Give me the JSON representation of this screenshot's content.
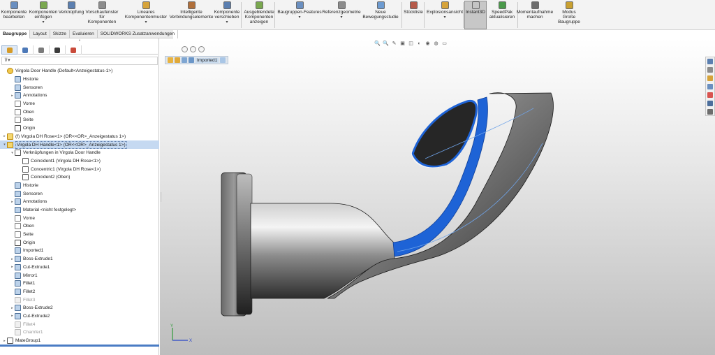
{
  "ribbon": {
    "buttons": [
      {
        "label": "Komponente\nbearbeiten",
        "icon": "edit-component-icon",
        "dropdown": false
      },
      {
        "label": "Komponenten\neinfügen",
        "icon": "insert-components-icon",
        "dropdown": true
      },
      {
        "label": "Verknüpfung",
        "icon": "mate-icon",
        "dropdown": false
      },
      {
        "label": "Vorschaufenster\nfür\nKomponenten",
        "icon": "component-preview-icon",
        "dropdown": false
      },
      {
        "label": "Lineares\nKomponentenmuster",
        "icon": "linear-pattern-icon",
        "dropdown": true
      },
      {
        "label": "Intelligente\nVerbindungselemente",
        "icon": "smart-fasteners-icon",
        "dropdown": false
      },
      {
        "label": "Komponente\nverschieben",
        "icon": "move-component-icon",
        "dropdown": true
      },
      {
        "label": "Ausgeblendete\nKomponenten\nanzeigen",
        "icon": "show-hidden-icon",
        "dropdown": false
      },
      {
        "label": "Baugruppen-Features",
        "icon": "assembly-features-icon",
        "dropdown": true
      },
      {
        "label": "Referenzgeometrie",
        "icon": "reference-geometry-icon",
        "dropdown": true
      },
      {
        "label": "Neue\nBewegungsstudie",
        "icon": "motion-study-icon",
        "dropdown": false
      },
      {
        "label": "Stückliste",
        "icon": "bom-icon",
        "dropdown": false
      },
      {
        "label": "Explosionsansicht",
        "icon": "exploded-view-icon",
        "dropdown": true
      },
      {
        "label": "Instant3D",
        "icon": "instant3d-icon",
        "dropdown": false
      },
      {
        "label": "SpeedPak\naktualisieren",
        "icon": "speedpak-icon",
        "dropdown": false
      },
      {
        "label": "Momentaufnahme\nmachen",
        "icon": "snapshot-icon",
        "dropdown": false
      },
      {
        "label": "Modus\nGroße\nBaugruppe",
        "icon": "large-assembly-icon",
        "dropdown": false
      }
    ],
    "dropdown_glyph": "▾",
    "active": "Instant3D"
  },
  "command_tabs": [
    "Baugruppe",
    "Layout",
    "Skizze",
    "Evaluieren",
    "SOLIDWORKS Zusatzanwendungen"
  ],
  "manager_tabs": [
    {
      "name": "featuremanager-tab",
      "icon": "featuremanager-icon",
      "color": "#d69b27"
    },
    {
      "name": "propertymanager-tab",
      "icon": "propertymanager-icon",
      "color": "#4d79b8"
    },
    {
      "name": "configurationmanager-tab",
      "icon": "configurationmanager-icon",
      "color": "#7a7a7a"
    },
    {
      "name": "dimxpertmanager-tab",
      "icon": "dimxpert-icon",
      "color": "#3b3b3b"
    },
    {
      "name": "displaymanager-tab",
      "icon": "displaymanager-icon",
      "color": "#c94a3a"
    }
  ],
  "filter": {
    "glyph": "▾"
  },
  "gripper_glyph": "•",
  "tree": [
    {
      "label": "Virgola Door Handle  (Default<Anzeigestatus-1>)",
      "icon": "asm",
      "indent": 0,
      "expand": ""
    },
    {
      "label": "Historie",
      "icon": "feat",
      "indent": 1,
      "expand": ""
    },
    {
      "label": "Sensoren",
      "icon": "feat",
      "indent": 1,
      "expand": ""
    },
    {
      "label": "Annotations",
      "icon": "feat",
      "indent": 1,
      "expand": "▸"
    },
    {
      "label": "Vorne",
      "icon": "plane",
      "indent": 1,
      "expand": ""
    },
    {
      "label": "Oben",
      "icon": "plane",
      "indent": 1,
      "expand": ""
    },
    {
      "label": "Seite",
      "icon": "plane",
      "indent": 1,
      "expand": ""
    },
    {
      "label": "Origin",
      "icon": "origin",
      "indent": 1,
      "expand": ""
    },
    {
      "label": "(f) Virgola DH Rose<1> (OR<<OR>_Anzeigestatus 1>)",
      "icon": "part",
      "indent": 0,
      "expand": "▸"
    },
    {
      "label": "Virgola DH Handle<1> (OR<<OR>_Anzeigestatus 1>)",
      "icon": "part",
      "indent": 0,
      "expand": "▾",
      "selected": true
    },
    {
      "label": "Verknüpfungen in Virgola Door Handle",
      "icon": "mate",
      "indent": 1,
      "expand": "▾"
    },
    {
      "label": "Coincident1 (Virgola DH Rose<1>)",
      "icon": "mate",
      "indent": 2,
      "expand": ""
    },
    {
      "label": "Concentric1 (Virgola DH Rose<1>)",
      "icon": "mate",
      "indent": 2,
      "expand": ""
    },
    {
      "label": "Coincident2 (Oben)",
      "icon": "mate",
      "indent": 2,
      "expand": ""
    },
    {
      "label": "Historie",
      "icon": "feat",
      "indent": 1,
      "expand": ""
    },
    {
      "label": "Sensoren",
      "icon": "feat",
      "indent": 1,
      "expand": ""
    },
    {
      "label": "Annotations",
      "icon": "feat",
      "indent": 1,
      "expand": "▸"
    },
    {
      "label": "Material <nicht festgelegt>",
      "icon": "feat",
      "indent": 1,
      "expand": ""
    },
    {
      "label": "Vorne",
      "icon": "plane",
      "indent": 1,
      "expand": ""
    },
    {
      "label": "Oben",
      "icon": "plane",
      "indent": 1,
      "expand": ""
    },
    {
      "label": "Seite",
      "icon": "plane",
      "indent": 1,
      "expand": ""
    },
    {
      "label": "Origin",
      "icon": "origin",
      "indent": 1,
      "expand": ""
    },
    {
      "label": "Imported1",
      "icon": "feat",
      "indent": 1,
      "expand": ""
    },
    {
      "label": "Boss-Extrude1",
      "icon": "feat",
      "indent": 1,
      "expand": "▸"
    },
    {
      "label": "Cut-Extrude1",
      "icon": "feat",
      "indent": 1,
      "expand": "▸"
    },
    {
      "label": "Mirror1",
      "icon": "feat",
      "indent": 1,
      "expand": ""
    },
    {
      "label": "Fillet1",
      "icon": "feat",
      "indent": 1,
      "expand": ""
    },
    {
      "label": "Fillet2",
      "icon": "feat",
      "indent": 1,
      "expand": ""
    },
    {
      "label": "Fillet3",
      "icon": "ghost",
      "indent": 1,
      "expand": "",
      "dim": true
    },
    {
      "label": "Boss-Extrude2",
      "icon": "feat",
      "indent": 1,
      "expand": "▸"
    },
    {
      "label": "Cut-Extrude2",
      "icon": "feat",
      "indent": 1,
      "expand": "▸"
    },
    {
      "label": "Fillet4",
      "icon": "ghost",
      "indent": 1,
      "expand": "",
      "dim": true
    },
    {
      "label": "Chamfer1",
      "icon": "ghost",
      "indent": 1,
      "expand": "",
      "dim": true
    },
    {
      "label": "MateGroup1",
      "icon": "mate",
      "indent": 0,
      "expand": "▸"
    }
  ],
  "viewport": {
    "heads_up": [
      "🔍",
      "🔍",
      "✎",
      "▣",
      "◫",
      "◐",
      "◉",
      "◍",
      "▭"
    ],
    "breadcrumb": {
      "label": "Imported1"
    },
    "task_pane_icons": [
      {
        "name": "resources-icon",
        "color": "#5b7fb0"
      },
      {
        "name": "design-library-icon",
        "color": "#8c8c8c"
      },
      {
        "name": "file-explorer-icon",
        "color": "#d6a33a"
      },
      {
        "name": "view-palette-icon",
        "color": "#6a8fc0"
      },
      {
        "name": "appearances-icon",
        "color": "#d9534f"
      },
      {
        "name": "custom-properties-icon",
        "color": "#4c6e9c"
      },
      {
        "name": "solidworks-forum-icon",
        "color": "#6d6d6d"
      }
    ],
    "selection_color": "#1e63d6",
    "triad": {
      "x": "X",
      "y": "Y"
    }
  }
}
